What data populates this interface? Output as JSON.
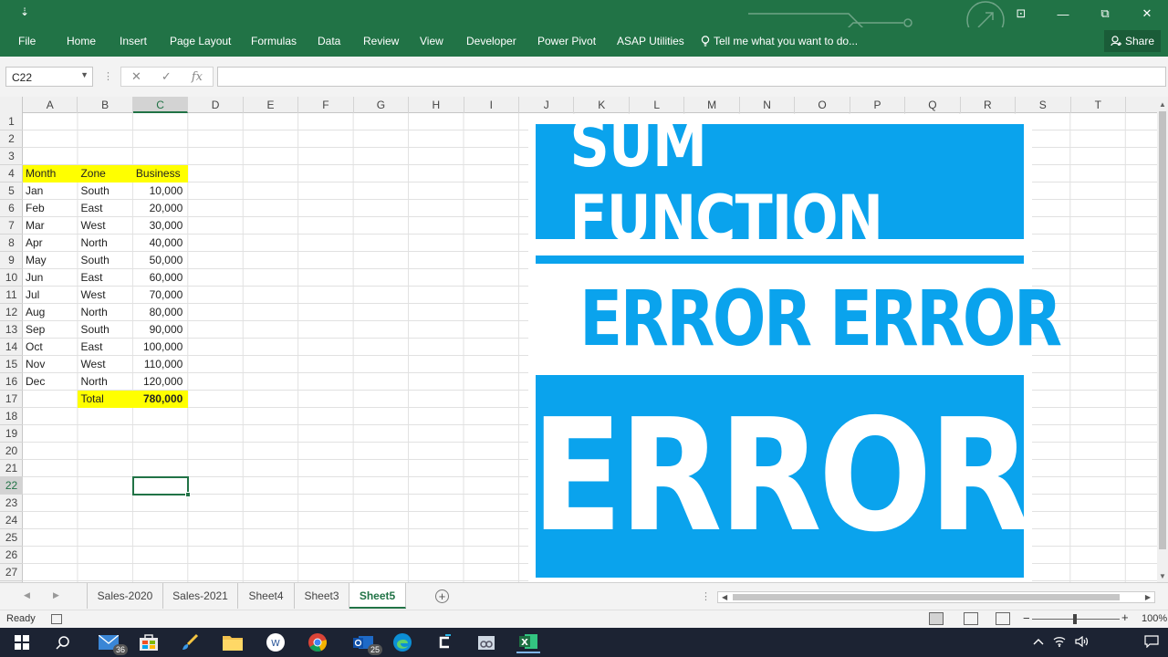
{
  "titlebar": {
    "quick_access_glyph": "⇣",
    "controls": {
      "ribbon_options": "⊡",
      "minimize": "—",
      "restore": "⧉",
      "close": "✕"
    }
  },
  "ribbon": {
    "tabs": [
      "File",
      "Home",
      "Insert",
      "Page Layout",
      "Formulas",
      "Data",
      "Review",
      "View",
      "Developer",
      "Power Pivot",
      "ASAP Utilities"
    ],
    "tell_me": "Tell me what you want to do...",
    "share": "Share"
  },
  "formula_bar": {
    "name_box": "C22",
    "cancel": "✕",
    "enter": "✓",
    "fx": "fx",
    "content": ""
  },
  "grid": {
    "columns": [
      "A",
      "B",
      "C",
      "D",
      "E",
      "F",
      "G",
      "H",
      "I",
      "J",
      "K",
      "L",
      "M",
      "N",
      "O",
      "P",
      "Q",
      "R",
      "S",
      "T"
    ],
    "selected_column": "C",
    "rows": [
      "1",
      "2",
      "3",
      "4",
      "5",
      "6",
      "7",
      "8",
      "9",
      "10",
      "11",
      "12",
      "13",
      "14",
      "15",
      "16",
      "17",
      "18",
      "19",
      "20",
      "21",
      "22",
      "23",
      "24",
      "25",
      "26",
      "27"
    ],
    "selected_row": "22",
    "headers": {
      "month": "Month",
      "zone": "Zone",
      "business": "Business"
    },
    "data": [
      {
        "month": "Jan",
        "zone": "South",
        "business": "10,000"
      },
      {
        "month": "Feb",
        "zone": "East",
        "business": "20,000"
      },
      {
        "month": "Mar",
        "zone": "West",
        "business": "30,000"
      },
      {
        "month": "Apr",
        "zone": "North",
        "business": "40,000"
      },
      {
        "month": "May",
        "zone": "South",
        "business": "50,000"
      },
      {
        "month": "Jun",
        "zone": "East",
        "business": "60,000"
      },
      {
        "month": "Jul",
        "zone": "West",
        "business": "70,000"
      },
      {
        "month": "Aug",
        "zone": "North",
        "business": "80,000"
      },
      {
        "month": "Sep",
        "zone": "South",
        "business": "90,000"
      },
      {
        "month": "Oct",
        "zone": "East",
        "business": "100,000"
      },
      {
        "month": "Nov",
        "zone": "West",
        "business": "110,000"
      },
      {
        "month": "Dec",
        "zone": "North",
        "business": "120,000"
      }
    ],
    "total_label": "Total",
    "total_value": "780,000",
    "highlight_color": "#ffff00"
  },
  "banner": {
    "line1": "SUM FUNCTION",
    "line2": "ERROR ERROR",
    "line3": "ERROR",
    "color": "#0aa3ed"
  },
  "sheets": {
    "tabs": [
      "Sales-2020",
      "Sales-2021",
      "Sheet4",
      "Sheet3",
      "Sheet5"
    ],
    "active": "Sheet5",
    "add": "+"
  },
  "status": {
    "ready": "Ready",
    "zoom": "100%",
    "zoom_minus": "−",
    "zoom_plus": "+"
  },
  "taskbar": {
    "mail_badge": "36",
    "outlook_badge": "25",
    "excel_label": "X"
  },
  "colors": {
    "excel_green": "#217346",
    "taskbar": "#1c2333"
  }
}
